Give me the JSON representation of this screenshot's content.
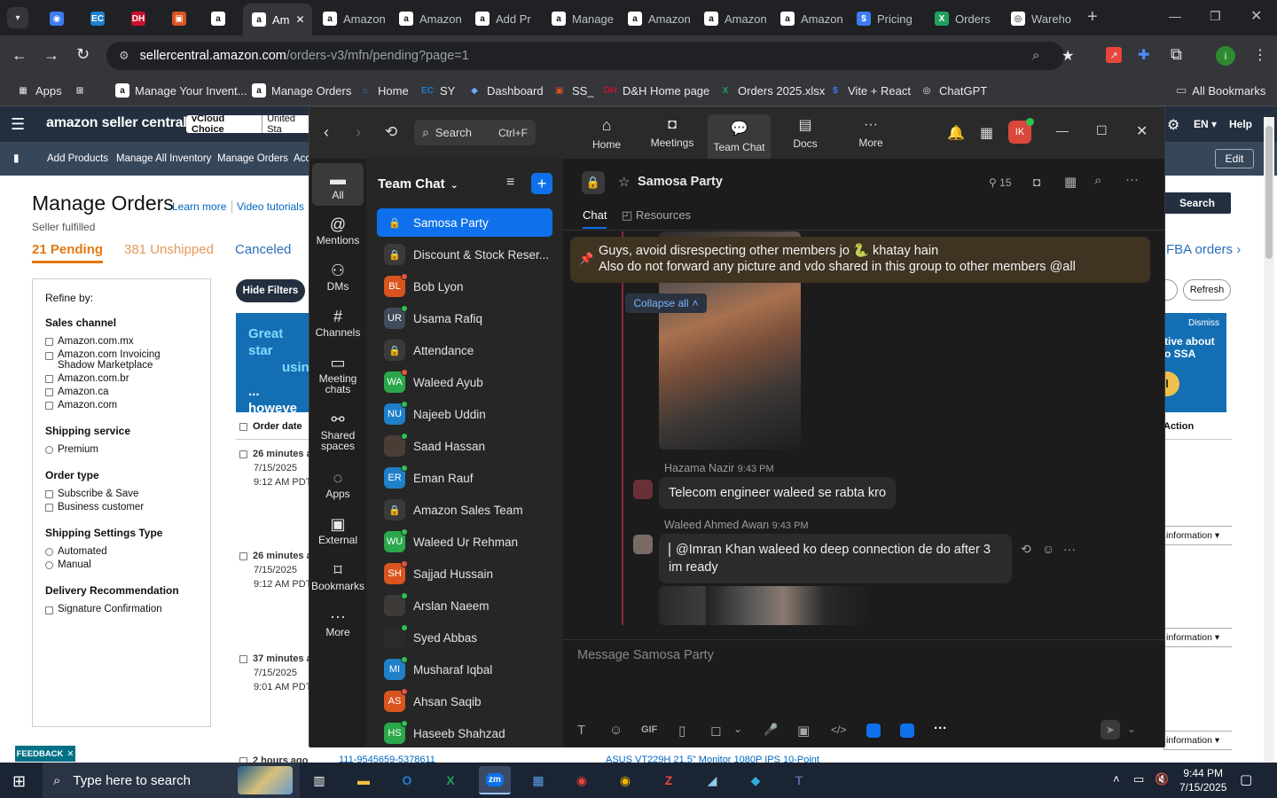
{
  "browser": {
    "tabs": [
      {
        "label": "",
        "icon": "chrome-icon"
      },
      {
        "label": "",
        "icon": "ec-icon"
      },
      {
        "label": "",
        "icon": "dh-icon"
      },
      {
        "label": "",
        "icon": "box-icon"
      },
      {
        "label": "",
        "icon": "amazon-icon"
      },
      {
        "label": "Am",
        "icon": "amazon-icon",
        "active": true
      },
      {
        "label": "Amazon",
        "icon": "amazon-icon"
      },
      {
        "label": "Amazon",
        "icon": "amazon-icon"
      },
      {
        "label": "Add Pr",
        "icon": "amazon-icon"
      },
      {
        "label": "Manage",
        "icon": "amazon-icon"
      },
      {
        "label": "Amazon",
        "icon": "amazon-icon"
      },
      {
        "label": "Amazon",
        "icon": "amazon-icon"
      },
      {
        "label": "Amazon",
        "icon": "amazon-icon"
      },
      {
        "label": "Pricing",
        "icon": "dollar-icon"
      },
      {
        "label": "Orders",
        "icon": "excel-icon"
      },
      {
        "label": "Wareho",
        "icon": "globe-icon"
      }
    ],
    "url_host": "sellercentral.amazon.com",
    "url_path": "/orders-v3/mfn/pending?page=1",
    "bookmarks": [
      "Apps",
      "Manage Your Invent...",
      "Manage Orders",
      "Home",
      "SY",
      "Dashboard",
      "SS_",
      "D&H Home page",
      "Orders 2025.xlsx",
      "Vite + React",
      "ChatGPT"
    ],
    "all_bookmarks": "All Bookmarks"
  },
  "amazon": {
    "logo": "amazon seller central",
    "store_badge": "vCloud Choice",
    "store_region": "United Sta",
    "search_btn": "Search",
    "lang": "EN",
    "help": "Help",
    "nav": [
      "Add Products",
      "Manage All Inventory",
      "Manage Orders",
      "Acc"
    ],
    "edit": "Edit",
    "page_title": "Manage Orders",
    "learn_more": "Learn more",
    "video_tutorials": "Video tutorials",
    "subtitle": "Seller fulfilled",
    "tabs": {
      "pending": "21 Pending",
      "unshipped": "381 Unshipped",
      "canceled": "Canceled"
    },
    "fba_link": "FBA orders",
    "refresh": "Refresh",
    "hide_filters": "Hide Filters",
    "refine_by": "Refine by:",
    "filters": [
      {
        "title": "Sales channel",
        "type": "check",
        "options": [
          "Amazon.com.mx",
          "Amazon.com Invoicing Shadow Marketplace",
          "Amazon.com.br",
          "Amazon.ca",
          "Amazon.com"
        ]
      },
      {
        "title": "Shipping service",
        "type": "radio",
        "options": [
          "Premium"
        ]
      },
      {
        "title": "Order type",
        "type": "check",
        "options": [
          "Subscribe & Save",
          "Business customer"
        ]
      },
      {
        "title": "Shipping Settings Type",
        "type": "radio",
        "options": [
          "Automated",
          "Manual"
        ]
      },
      {
        "title": "Delivery Recommendation",
        "type": "check",
        "options": [
          "Signature Confirmation"
        ]
      }
    ],
    "banner_left": [
      "Great star",
      "usin",
      "... howeve"
    ],
    "banner_right": {
      "dismiss": "Dismiss",
      "line1": "tive about",
      "line2": "o SSA"
    },
    "col_order_date": "Order date",
    "col_action": "Action",
    "orders": [
      {
        "age": "26 minutes ag",
        "date": "7/15/2025",
        "time": "9:12 AM PDT"
      },
      {
        "age": "26 minutes ag",
        "date": "7/15/2025",
        "time": "9:12 AM PDT"
      },
      {
        "age": "37 minutes ag",
        "date": "7/15/2025",
        "time": "9:01 AM PDT"
      },
      {
        "age": "2 hours ago",
        "date": "",
        "time": ""
      }
    ],
    "more_info": "information",
    "bottom_row_id": "111-9545659-5378611",
    "bottom_row_product": "ASUS VT229H 21.5\" Monitor 1080P IPS 10-Point",
    "feedback": "FEEDBACK"
  },
  "zoom": {
    "search_label": "Search",
    "search_shortcut": "Ctrl+F",
    "top_tabs": [
      "Home",
      "Meetings",
      "Team Chat",
      "Docs",
      "More"
    ],
    "avatar_initials": "IK",
    "rail": [
      "All",
      "Mentions",
      "DMs",
      "Channels",
      "Meeting chats",
      "Shared spaces",
      "Apps",
      "External",
      "Bookmarks",
      "More"
    ],
    "list_title": "Team Chat",
    "chats": [
      {
        "name": "Samosa Party",
        "type": "lock",
        "selected": true
      },
      {
        "name": "Discount & Stock Reser...",
        "type": "lock"
      },
      {
        "name": "Bob Lyon",
        "initials": "BL",
        "color": "#d9541e",
        "status": "#e8533b"
      },
      {
        "name": "Usama Rafiq",
        "initials": "UR",
        "color": "#3f4a5a",
        "status": "#2bc451"
      },
      {
        "name": "Attendance",
        "type": "lock"
      },
      {
        "name": "Waleed Ayub",
        "initials": "WA",
        "color": "#2aa84a",
        "status": "#e8533b"
      },
      {
        "name": "Najeeb Uddin",
        "initials": "NU",
        "color": "#1f7fc9",
        "status": "#2bc451"
      },
      {
        "name": "Saad Hassan",
        "initials": "",
        "color": "#4a3d35",
        "status": "#2bc451"
      },
      {
        "name": "Eman Rauf",
        "initials": "ER",
        "color": "#1f7fc9",
        "status": "#2bc451"
      },
      {
        "name": "Amazon Sales Team",
        "type": "lock"
      },
      {
        "name": "Waleed Ur Rehman",
        "initials": "WU",
        "color": "#2aa84a",
        "status": "#2bc451"
      },
      {
        "name": "Sajjad Hussain",
        "initials": "SH",
        "color": "#d9541e",
        "status": "#e8533b"
      },
      {
        "name": "Arslan Naeem",
        "initials": "",
        "color": "#3d3a38",
        "status": "#2bc451"
      },
      {
        "name": "Syed Abbas",
        "initials": "",
        "color": "#2b2b2b",
        "status": "#2bc451"
      },
      {
        "name": "Musharaf Iqbal",
        "initials": "MI",
        "color": "#1f7fc9",
        "status": "#2bc451"
      },
      {
        "name": "Ahsan Saqib",
        "initials": "AS",
        "color": "#d9541e",
        "status": "#e8533b"
      },
      {
        "name": "Haseeb Shahzad",
        "initials": "HS",
        "color": "#2aa84a",
        "status": "#2bc451"
      }
    ],
    "channel_name": "Samosa Party",
    "member_count": "15",
    "chat_tab": "Chat",
    "resources_tab": "Resources",
    "pinned_line1": "Guys, avoid disrespecting other members jo 🐍 khatay hain",
    "pinned_line2": "Also do not forward any picture and vdo shared in this group to other members @all",
    "collapse_all": "Collapse all",
    "messages": [
      {
        "sender": "Hazama Nazir",
        "time": "9:43 PM",
        "text": "Telecom engineer waleed se rabta kro"
      },
      {
        "sender": "Waleed Ahmed Awan",
        "time": "9:43 PM",
        "text": "@Imran Khan waleed ko deep connection de do after 3 im ready"
      }
    ],
    "composer_placeholder": "Message Samosa Party",
    "composer_tools": [
      "T",
      "☺",
      "GIF",
      "▯",
      "◻",
      "⌄",
      "🎤",
      "▣",
      "</>"
    ]
  },
  "taskbar": {
    "search_placeholder": "Type here to search",
    "time": "9:44 PM",
    "date": "7/15/2025"
  }
}
